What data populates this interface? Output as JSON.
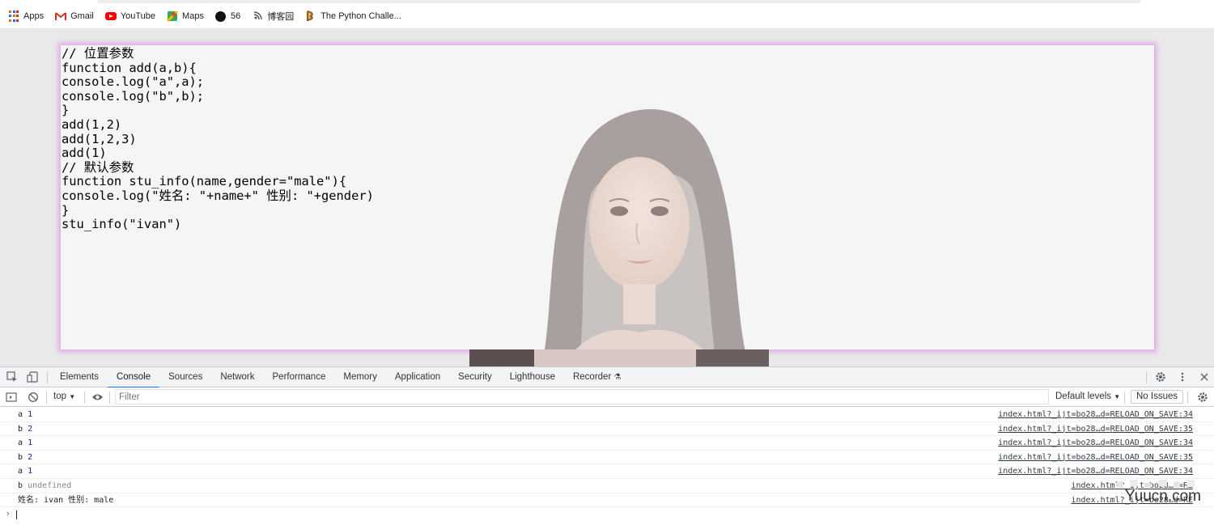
{
  "bookmarks": [
    {
      "label": "Apps",
      "icon": "apps-grid-icon"
    },
    {
      "label": "Gmail",
      "icon": "gmail-icon"
    },
    {
      "label": "YouTube",
      "icon": "youtube-icon"
    },
    {
      "label": "Maps",
      "icon": "maps-icon"
    },
    {
      "label": "56",
      "icon": "site-56-icon"
    },
    {
      "label": "博客园",
      "icon": "cnblogs-icon"
    },
    {
      "label": "The Python Challe...",
      "icon": "python-challenge-icon"
    }
  ],
  "page": {
    "code_lines": [
      "// 位置参数",
      "function add(a,b){",
      "console.log(\"a\",a);",
      "console.log(\"b\",b);",
      "}",
      "add(1,2)",
      "add(1,2,3)",
      "add(1)",
      "// 默认参数",
      "function stu_info(name,gender=\"male\"){",
      "console.log(\"姓名: \"+name+\" 性别: \"+gender)",
      "}",
      "stu_info(\"ivan\")"
    ]
  },
  "devtools": {
    "tabs": [
      "Elements",
      "Console",
      "Sources",
      "Network",
      "Performance",
      "Memory",
      "Application",
      "Security",
      "Lighthouse",
      "Recorder"
    ],
    "active_tab": "Console",
    "toolbar": {
      "context": "top",
      "filter_placeholder": "Filter",
      "levels": "Default levels",
      "issues": "No Issues"
    },
    "console_rows": [
      {
        "label": "a",
        "value": "1",
        "kind": "number",
        "source": "index.html?_ijt=bo28…d=RELOAD_ON_SAVE:34"
      },
      {
        "label": "b",
        "value": "2",
        "kind": "number",
        "source": "index.html?_ijt=bo28…d=RELOAD_ON_SAVE:35"
      },
      {
        "label": "a",
        "value": "1",
        "kind": "number",
        "source": "index.html?_ijt=bo28…d=RELOAD_ON_SAVE:34"
      },
      {
        "label": "b",
        "value": "2",
        "kind": "number",
        "source": "index.html?_ijt=bo28…d=RELOAD_ON_SAVE:35"
      },
      {
        "label": "a",
        "value": "1",
        "kind": "number",
        "source": "index.html?_ijt=bo28…d=RELOAD_ON_SAVE:34"
      },
      {
        "label": "b",
        "value": "undefined",
        "kind": "undefined",
        "source": "index.html?_ijt=bo28…d=RE"
      },
      {
        "label": "姓名: ivan 性别: male",
        "value": "",
        "kind": "string",
        "source": "index.html?_ijt=bo28…d=RE"
      }
    ]
  },
  "watermark": "Yuucn.com",
  "colors": {
    "accent": "#1a73e8",
    "card_glow": "#e0a9e6",
    "number": "#1a1aa6"
  }
}
